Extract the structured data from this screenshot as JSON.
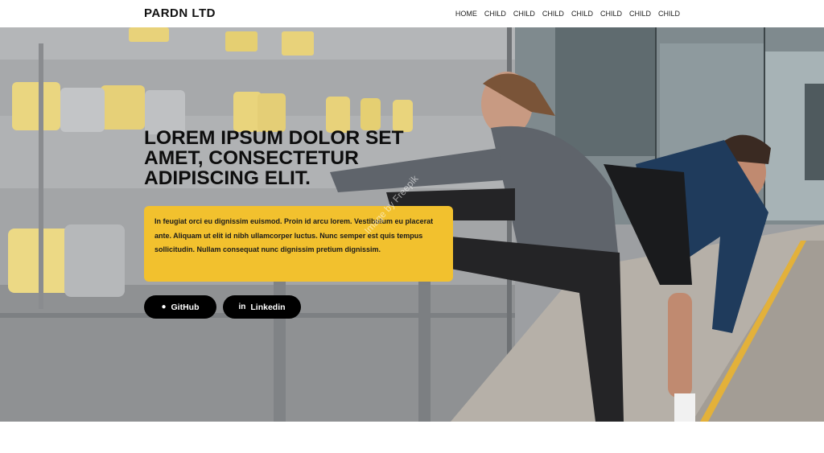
{
  "brand": "PARDN LTD",
  "nav": [
    "HOME",
    "CHILD",
    "CHILD",
    "CHILD",
    "CHILD",
    "CHILD",
    "CHILD",
    "CHILD"
  ],
  "hero": {
    "headline": "LOREM IPSUM DOLOR SET AMET, CONSECTETUR ADIPISCING ELIT.",
    "description": "In feugiat orci eu dignissim euismod. Proin id arcu lorem. Vestibulum eu placerat ante. Aliquam ut elit id nibh ullamcorper luctus. Nunc semper est quis tempus sollicitudin. Nullam consequat nunc dignissim pretium dignissim.",
    "buttons": {
      "github": "GitHub",
      "linkedin": "Linkedin"
    },
    "watermark": "Image by Freepik"
  },
  "colors": {
    "accent": "#f2c12e",
    "button": "#000000"
  },
  "icons": {
    "github": "github-icon",
    "linkedin": "linkedin-icon"
  }
}
